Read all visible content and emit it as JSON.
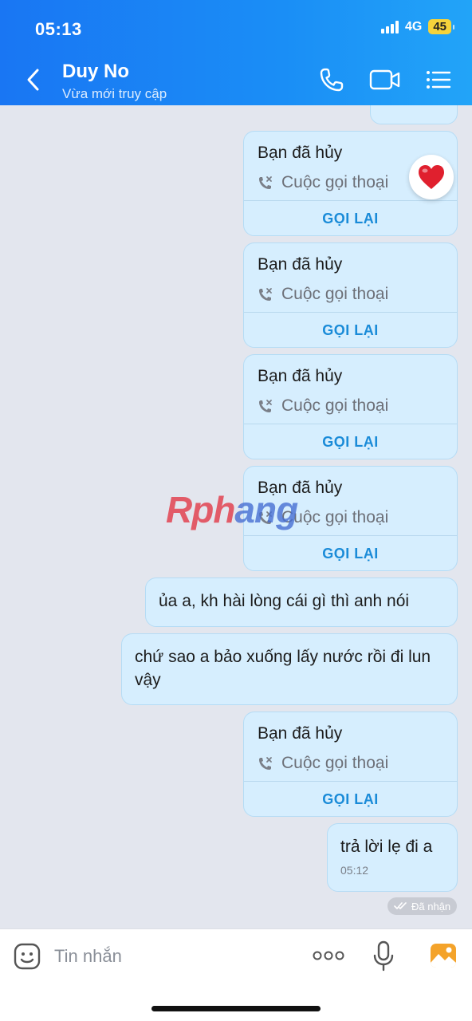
{
  "status_bar": {
    "time": "05:13",
    "network": "4G",
    "battery": "45"
  },
  "header": {
    "contact_name": "Duy No",
    "contact_status": "Vừa mới truy cập"
  },
  "call_cards": [
    {
      "title": "Bạn đã hủy",
      "subtitle": "Cuộc gọi thoại",
      "action": "GỌI LẠI"
    },
    {
      "title": "Bạn đã hủy",
      "subtitle": "Cuộc gọi thoại",
      "action": "GỌI LẠI"
    },
    {
      "title": "Bạn đã hủy",
      "subtitle": "Cuộc gọi thoại",
      "action": "GỌI LẠI"
    },
    {
      "title": "Bạn đã hủy",
      "subtitle": "Cuộc gọi thoại",
      "action": "GỌI LẠI"
    },
    {
      "title": "Bạn đã hủy",
      "subtitle": "Cuộc gọi thoại",
      "action": "GỌI LẠI"
    }
  ],
  "messages": [
    {
      "text": "ủa a, kh hài lòng cái gì thì anh nói"
    },
    {
      "text": "chứ sao a bảo xuống lấy nước rồi đi lun vậy"
    },
    {
      "text": "trả lời lẹ đi a",
      "time": "05:12"
    }
  ],
  "delivery_status": "Đã nhận",
  "watermark": {
    "part1": "Rph",
    "part2": "ang"
  },
  "input": {
    "placeholder": "Tin nhắn"
  },
  "colors": {
    "header_start": "#1976f3",
    "header_end": "#22a4f8",
    "bubble": "#d6eefe",
    "action": "#1a8bd8",
    "reaction": "#e0202e"
  },
  "icons": [
    "back-icon",
    "phone-icon",
    "video-call-icon",
    "menu-icon",
    "missed-call-icon",
    "heart-icon",
    "double-check-icon",
    "sticker-icon",
    "more-icon",
    "mic-icon",
    "image-icon"
  ]
}
